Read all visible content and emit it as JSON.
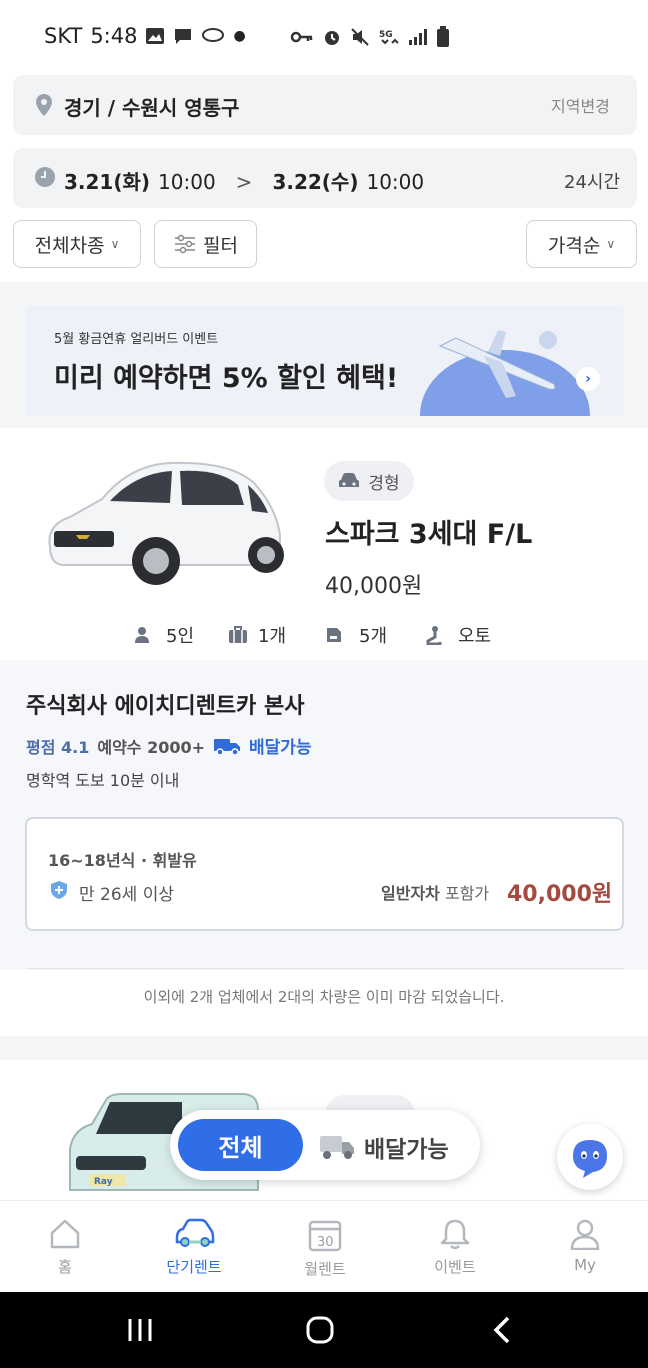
{
  "status_bar": {
    "carrier": "SKT",
    "time": "5:48"
  },
  "location": {
    "text": "경기 / 수원시 영통구",
    "change_label": "지역변경"
  },
  "dates": {
    "start_date": "3.21(화)",
    "start_time": "10:00",
    "arrow": ">",
    "end_date": "3.22(수)",
    "end_time": "10:00",
    "duration": "24시간"
  },
  "filters": {
    "car_type": "전체차종",
    "filter": "필터",
    "sort": "가격순"
  },
  "banner": {
    "subtitle": "5월 황금연휴 얼리버드 이벤트",
    "title": "미리 예약하면 5% 할인 혜택!"
  },
  "car": {
    "type": "경형",
    "name": "스파크 3세대 F/L",
    "price": "40,000원",
    "specs": {
      "seats": "5인",
      "luggage": "1개",
      "bags": "5개",
      "transmission": "오토"
    }
  },
  "company": {
    "name": "주식회사 에이치디렌트카 본사",
    "rating": "평점 4.1",
    "reservations": "예약수 2000+",
    "delivery": "배달가능",
    "near": "명학역 도보 10분 이내"
  },
  "offer": {
    "year_fuel": "16~18년식 · 휘발유",
    "age": "만 26세 이상",
    "insurance_type": "일반자차",
    "insurance_suffix": "포함가",
    "price": "40,000원"
  },
  "closed_message": "이외에 2개 업체에서 2대의 차량은 이미 마감 되었습니다.",
  "second_car": {
    "badge": "Ray"
  },
  "float_toggle": {
    "all": "전체",
    "delivery": "배달가능"
  },
  "tabs": [
    {
      "label": "홈"
    },
    {
      "label": "단기렌트"
    },
    {
      "label": "월렌트",
      "icon_number": "30"
    },
    {
      "label": "이벤트"
    },
    {
      "label": "My"
    }
  ],
  "colors": {
    "accent": "#2f6ee6",
    "price": "#a54a3f"
  }
}
